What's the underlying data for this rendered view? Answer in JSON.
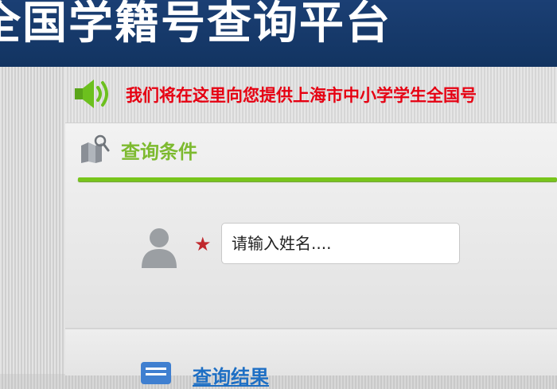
{
  "header": {
    "title": "全国学籍号查询平台"
  },
  "notice": {
    "text": "我们将在这里向您提供上海市中小学学生全国号"
  },
  "query_panel": {
    "title": "查询条件",
    "name_input": {
      "placeholder": "请输入姓名....",
      "value": ""
    },
    "required_mark": "★"
  },
  "result_panel": {
    "title": "查询结果"
  },
  "icons": {
    "speaker": "speaker-icon",
    "query": "map-pin-icon",
    "user": "user-avatar-icon",
    "result": "document-list-icon"
  },
  "colors": {
    "header_bg": "#1b3f74",
    "notice_text": "#e60012",
    "accent_green": "#7dba2f",
    "result_blue": "#1e6fc4",
    "required_red": "#c0282d"
  }
}
